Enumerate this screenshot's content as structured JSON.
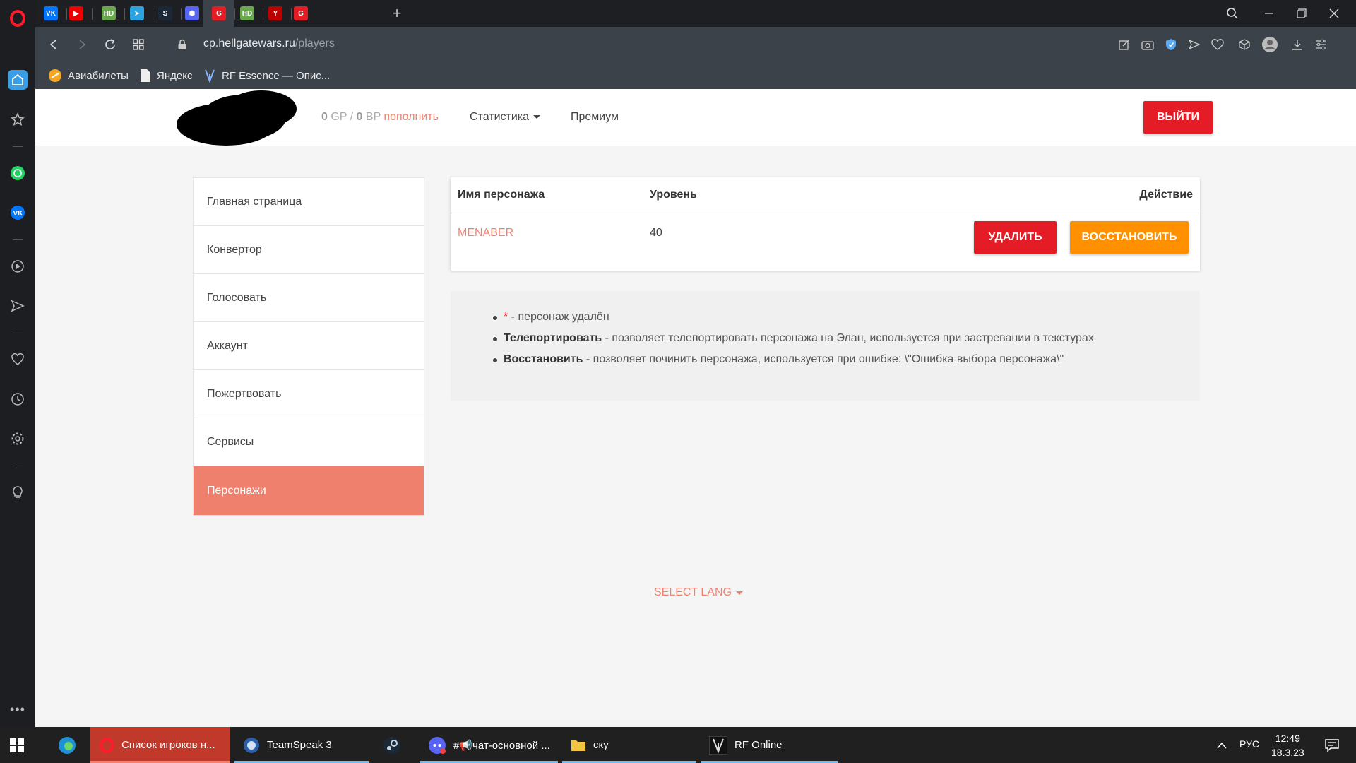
{
  "browser": {
    "url_domain": "cp.hellgatewars.ru",
    "url_path": "/players",
    "bookmarks": [
      "Авиабилеты",
      "Яндекс",
      "RF Essence — Опис..."
    ],
    "tabs": [
      {
        "icon": "vk-icon",
        "label": "VK",
        "color": "#0077ff"
      },
      {
        "icon": "youtube-icon",
        "label": "▶",
        "color": "#e00"
      },
      {
        "icon": "hd-icon",
        "label": "HD",
        "color": "#6aa84f"
      },
      {
        "icon": "telegram-icon",
        "label": "➤",
        "color": "#2aa3df"
      },
      {
        "icon": "steam-icon",
        "label": "S",
        "color": "#1b2838"
      },
      {
        "icon": "hexagon-icon",
        "label": "⬢",
        "color": "#5865f2"
      },
      {
        "icon": "hellgate-icon",
        "label": "G",
        "color": "#e31c25"
      },
      {
        "icon": "hd-icon",
        "label": "HD",
        "color": "#6aa84f"
      },
      {
        "icon": "nexon-icon",
        "label": "Y",
        "color": "#b00"
      },
      {
        "icon": "hellgate-icon",
        "label": "G",
        "color": "#e31c25"
      }
    ]
  },
  "header": {
    "gp_value": "0",
    "gp_unit": "GP",
    "separator": "/",
    "bp_value": "0",
    "bp_unit": "BP",
    "topup_label": "пополнить",
    "nav_stats": "Статистика",
    "nav_premium": "Премиум",
    "logout_label": "ВЫЙТИ"
  },
  "menu": [
    "Главная страница",
    "Конвертор",
    "Голосовать",
    "Аккаунт",
    "Пожертвовать",
    "Сервисы",
    "Персонажи"
  ],
  "table": {
    "col_name": "Имя персонажа",
    "col_level": "Уровень",
    "col_action": "Действие",
    "row": {
      "name": "MENABER",
      "level": "40",
      "delete_label": "УДАЛИТЬ",
      "restore_label": "ВОССТАНОВИТЬ"
    }
  },
  "info": {
    "star": "*",
    "star_text": " - персонаж удалён",
    "teleport_bold": "Телепортировать",
    "teleport_text": " - позволяет телепортировать персонажа на Элан, используется при застревании в текстурах",
    "restore_bold": "Восстановить",
    "restore_text": " - позволяет починить персонажа, используется при ошибке: \\\"Ошибка выбора персонажа\\\""
  },
  "footer": {
    "select_lang": "SELECT LANG"
  },
  "taskbar": {
    "apps": [
      {
        "label": "Список игроков н...",
        "icon": "opera-icon"
      },
      {
        "label": "TeamSpeak 3",
        "icon": "teamspeak-icon"
      },
      {
        "label": "",
        "icon": "steam-icon"
      },
      {
        "label": "#📢чат-основной ...",
        "icon": "discord-icon"
      },
      {
        "label": "ску",
        "icon": "folder-icon"
      },
      {
        "label": "RF Online",
        "icon": "rf-online-icon"
      }
    ],
    "lang": "РУС",
    "time": "12:49",
    "date": "18.3.23"
  },
  "colors": {
    "accent": "#f0806e",
    "danger": "#e31c25",
    "warning": "#ff9100"
  }
}
